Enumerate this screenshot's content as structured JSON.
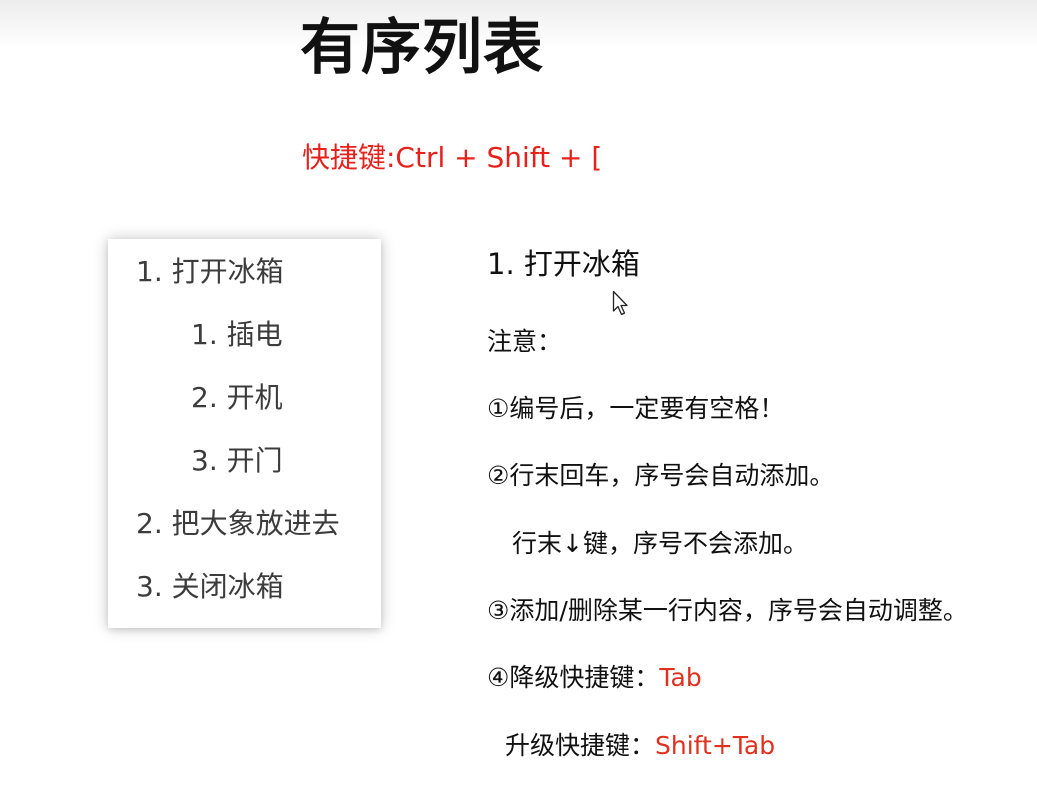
{
  "title": "有序列表",
  "shortcut": "快捷键:Ctrl + Shift + [",
  "example_list": {
    "item1": "1. 打开冰箱",
    "item1_sub1": "1. 插电",
    "item1_sub2": "2. 开机",
    "item1_sub3": "3. 开门",
    "item2": "2. 把大象放进去",
    "item3": "3. 关闭冰箱"
  },
  "notes": {
    "heading": "1. 打开冰箱",
    "attention": "注意：",
    "rule1": "①编号后，一定要有空格！",
    "rule2": "②行末回车，序号会自动添加。",
    "rule2b": "行末↓键，序号不会添加。",
    "rule3": "③添加/删除某一行内容，序号会自动调整。",
    "rule4_label": "④降级快捷键：",
    "rule4_key": "Tab",
    "rule5_label": "升级快捷键：",
    "rule5_key": "Shift+Tab"
  },
  "colors": {
    "accent_red": "#e6211c"
  },
  "icons": {
    "cursor": "mouse-pointer-icon"
  }
}
